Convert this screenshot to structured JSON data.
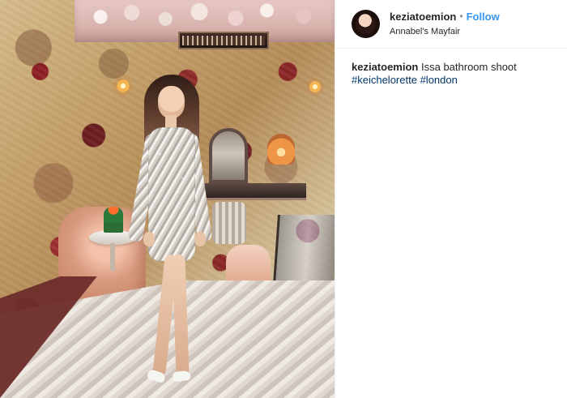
{
  "profile": {
    "username": "keziatoemion",
    "follow_label": "Follow",
    "location": "Annabel's Mayfair"
  },
  "caption": {
    "username": "keziatoemion",
    "text": "Issa bathroom shoot",
    "hashtags": [
      "#keichelorette",
      "#london"
    ]
  },
  "icons": {
    "avatar": "profile-photo",
    "separator": "dot"
  },
  "colors": {
    "follow": "#3897f0",
    "hashtag": "#003569",
    "text": "#262626",
    "background": "#ffffff"
  }
}
